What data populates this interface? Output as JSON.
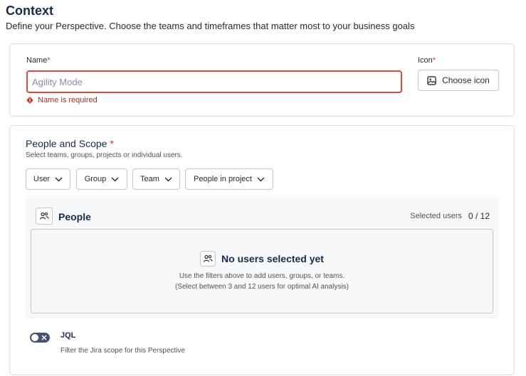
{
  "header": {
    "title": "Context",
    "subtitle": "Define your Perspective. Choose the teams and timeframes that matter most to your business goals"
  },
  "name_card": {
    "name_label": "Name",
    "icon_label": "Icon",
    "required_marker": "*",
    "name_placeholder": "Agility Mode",
    "name_value": "",
    "error_text": "Name is required",
    "choose_icon_label": "Choose icon"
  },
  "scope_card": {
    "title": "People and Scope",
    "required_marker": "*",
    "help": "Select teams, groups, projects or individual users.",
    "filters": [
      {
        "label": "User"
      },
      {
        "label": "Group"
      },
      {
        "label": "Team"
      },
      {
        "label": "People in project"
      }
    ],
    "people_panel": {
      "title": "People",
      "selected_label": "Selected users",
      "selected_count": "0",
      "selected_max": "12",
      "empty_title": "No users selected yet",
      "empty_line1": "Use the filters above to add users, groups, or teams.",
      "empty_line2": "(Select between 3 and 12 users for optimal AI analysis)"
    },
    "jql": {
      "label": "JQL",
      "help": "Filter the Jira scope for this Perspective",
      "enabled": false
    }
  },
  "colors": {
    "error": "#e2483d",
    "error_text": "#ae2e24",
    "toggle_off": "#44546f",
    "panel_bg": "#f7f8f9"
  },
  "icons": {
    "error": "error-diamond-icon",
    "choose_icon": "image-icon",
    "chevron": "chevron-down-icon",
    "people": "people-icon",
    "toggle": "close-icon"
  }
}
